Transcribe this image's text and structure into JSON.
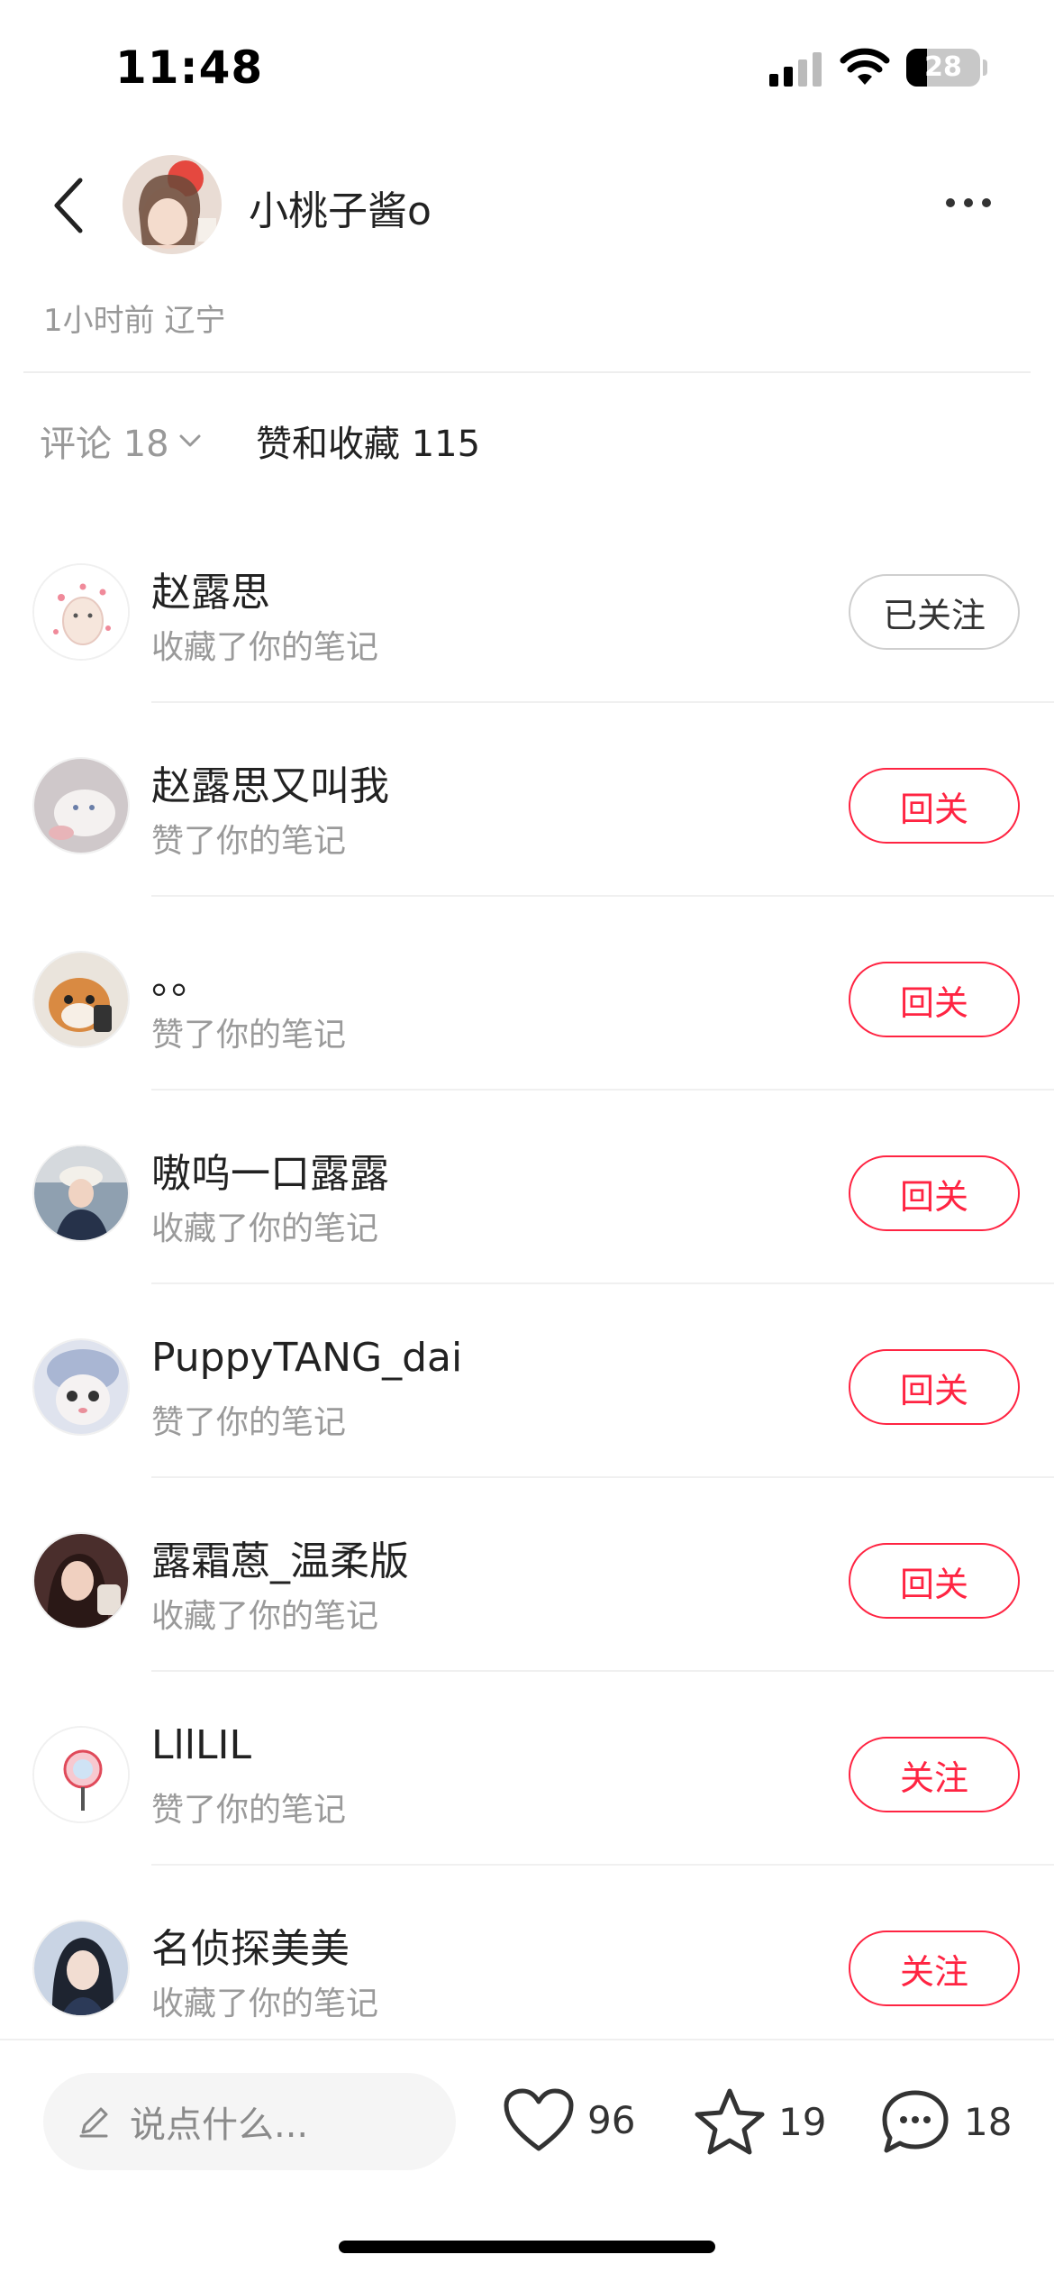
{
  "status": {
    "time": "11:48",
    "battery": "28",
    "battery_level": 0.28
  },
  "header": {
    "author": "小桃子酱o"
  },
  "post": {
    "meta": "1小时前 辽宁"
  },
  "tabs": {
    "comments": "评论 18",
    "likes": "赞和收藏 115"
  },
  "rows": [
    {
      "name": "赵露思",
      "action": "收藏了你的笔记",
      "button": "已关注",
      "followed": true,
      "avatar_color": "#fbeef0"
    },
    {
      "name": "赵露思又叫我",
      "action": "赞了你的笔记",
      "button": "回关",
      "followed": false,
      "avatar_color": "#c9c2c4"
    },
    {
      "name": "。。",
      "action": "赞了你的笔记",
      "button": "回关",
      "followed": false,
      "avatar_color": "#d79a5a"
    },
    {
      "name": "嗷呜一口露露",
      "action": "收藏了你的笔记",
      "button": "回关",
      "followed": false,
      "avatar_color": "#6f8aa6"
    },
    {
      "name": "PuppyTANG_dai",
      "action": "赞了你的笔记",
      "button": "回关",
      "followed": false,
      "avatar_color": "#b8c4dc"
    },
    {
      "name": "露霜蒽_温柔版",
      "action": "收藏了你的笔记",
      "button": "回关",
      "followed": false,
      "avatar_color": "#8a4f4a"
    },
    {
      "name": "LllLIL",
      "action": "赞了你的笔记",
      "button": "关注",
      "followed": false,
      "avatar_color": "#ffffff"
    },
    {
      "name": "名侦探美美",
      "action": "收藏了你的笔记",
      "button": "关注",
      "followed": false,
      "avatar_color": "#3a4860"
    }
  ],
  "bottom": {
    "placeholder": "说点什么...",
    "likes": "96",
    "collects": "19",
    "comments": "18"
  },
  "colors": {
    "accent": "#ff2442"
  }
}
